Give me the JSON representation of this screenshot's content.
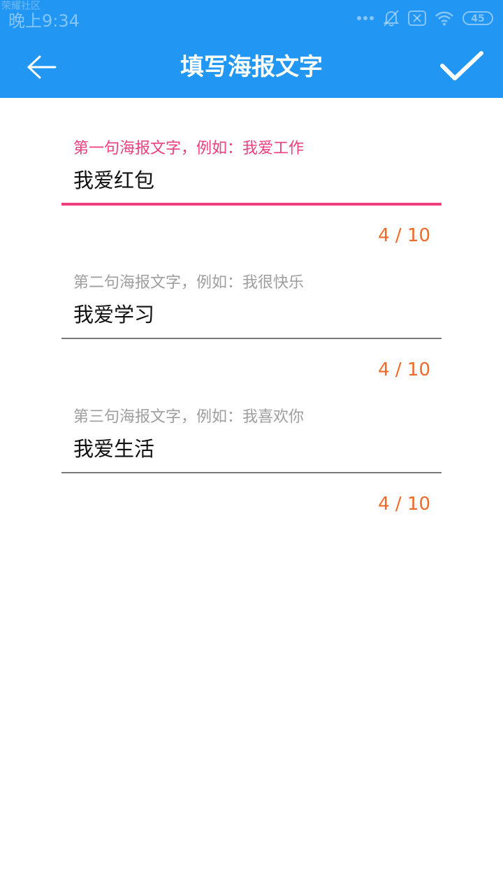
{
  "status_bar": {
    "watermark": "荣耀社区",
    "time": "晚上9:34",
    "battery": "45"
  },
  "header": {
    "title": "填写海报文字",
    "back_icon": "arrow-left-icon",
    "confirm_icon": "checkmark-icon",
    "background_color": "#2196F3"
  },
  "fields": [
    {
      "hint": "第一句海报文字，例如：我爱工作",
      "value": "我爱红包",
      "counter": "4 / 10"
    },
    {
      "hint": "第二句海报文字，例如：我很快乐",
      "value": "我爱学习",
      "counter": "4 / 10"
    },
    {
      "hint": "第三句海报文字，例如：我喜欢你",
      "value": "我爱生活",
      "counter": "4 / 10"
    }
  ],
  "colors": {
    "focused_accent": "#ee3e7d",
    "counter": "#f06a2a"
  }
}
